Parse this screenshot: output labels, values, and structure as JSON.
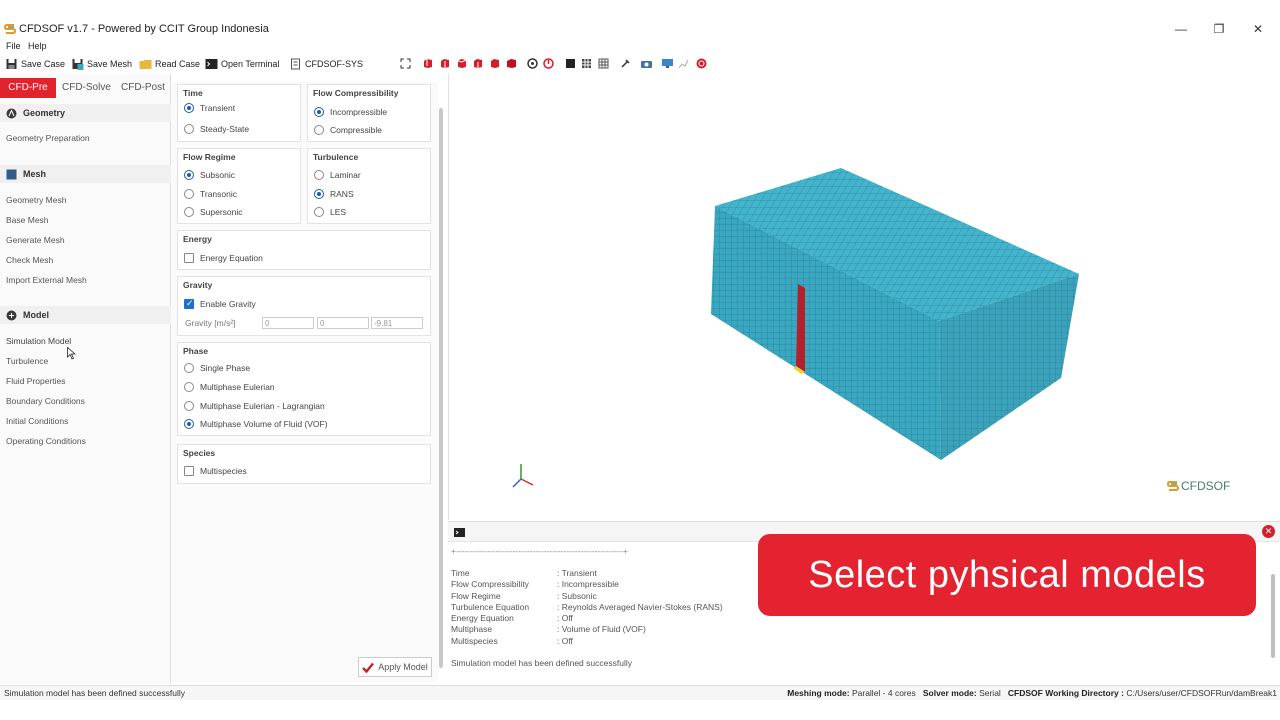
{
  "window": {
    "title": "CFDSOF v1.7 - Powered by CCIT Group Indonesia",
    "minimize": "—",
    "restore": "❐",
    "close": "✕"
  },
  "menu": {
    "file": "File",
    "help": "Help"
  },
  "toolbar": {
    "save_case": "Save Case",
    "save_mesh": "Save Mesh",
    "read_case": "Read Case",
    "open_terminal": "Open Terminal",
    "cfdsof_sys": "CFDSOF-SYS"
  },
  "nav": {
    "tabs": [
      "CFD-Pre",
      "CFD-Solve",
      "CFD-Post"
    ],
    "sections": {
      "geometry": {
        "title": "Geometry",
        "items": [
          "Geometry Preparation"
        ]
      },
      "mesh": {
        "title": "Mesh",
        "items": [
          "Geometry Mesh",
          "Base Mesh",
          "Generate Mesh",
          "Check Mesh",
          "Import External Mesh"
        ]
      },
      "model": {
        "title": "Model",
        "items": [
          "Simulation Model",
          "Turbulence",
          "Fluid Properties",
          "Boundary Conditions",
          "Initial Conditions",
          "Operating Conditions"
        ]
      }
    }
  },
  "panel": {
    "time": {
      "title": "Time",
      "options": [
        "Transient",
        "Steady-State"
      ],
      "selected": "Transient"
    },
    "compressibility": {
      "title": "Flow Compressibility",
      "options": [
        "Incompressible",
        "Compressible"
      ],
      "selected": "Incompressible"
    },
    "regime": {
      "title": "Flow Regime",
      "options": [
        "Subsonic",
        "Transonic",
        "Supersonic"
      ],
      "selected": "Subsonic"
    },
    "turbulence": {
      "title": "Turbulence",
      "options": [
        "Laminar",
        "RANS",
        "LES"
      ],
      "selected": "RANS"
    },
    "energy": {
      "title": "Energy",
      "label": "Energy Equation",
      "checked": false
    },
    "gravity": {
      "title": "Gravity",
      "label": "Enable Gravity",
      "checked": true,
      "field_label": "Gravity [m/s²]",
      "x": "0",
      "y": "0",
      "z": "-9.81"
    },
    "phase": {
      "title": "Phase",
      "options": [
        "Single Phase",
        "Multiphase Eulerian",
        "Multiphase Eulerian - Lagrangian",
        "Multiphase Volume of Fluid (VOF)"
      ],
      "selected": "Multiphase Volume of Fluid (VOF)"
    },
    "species": {
      "title": "Species",
      "label": "Multispecies",
      "checked": false
    },
    "apply_label": "Apply Model"
  },
  "viewport": {
    "watermark": "CFDSOF"
  },
  "console": {
    "separator": "+-----------------------------------------------------------+",
    "lines": [
      {
        "key": "Time",
        "value": ": Transient"
      },
      {
        "key": "Flow Compressibility",
        "value": ": Incompressible"
      },
      {
        "key": "Flow Regime",
        "value": ": Subsonic"
      },
      {
        "key": "Turbulence Equation",
        "value": ": Reynolds Averaged Navier-Stokes (RANS)"
      },
      {
        "key": "Energy Equation",
        "value": ": Off"
      },
      {
        "key": "Multiphase",
        "value": ": Volume of Fluid (VOF)"
      },
      {
        "key": "Multispecies",
        "value": ": Off"
      }
    ],
    "final": "Simulation model has been defined successfully"
  },
  "banner": {
    "text": "Select pyhsical models"
  },
  "status": {
    "left": "Simulation model has been defined successfully",
    "meshing_label": "Meshing mode:",
    "meshing_value": "Parallel - 4 cores",
    "solver_label": "Solver mode:",
    "solver_value": "Serial",
    "dir_label": "CFDSOF Working Directory :",
    "dir_value": "C:/Users/user/CFDSOFRun/damBreak1"
  },
  "colors": {
    "accent": "#e2222c",
    "mesh_cube": "#3ba7c0",
    "selection": "#1c5bb0"
  }
}
